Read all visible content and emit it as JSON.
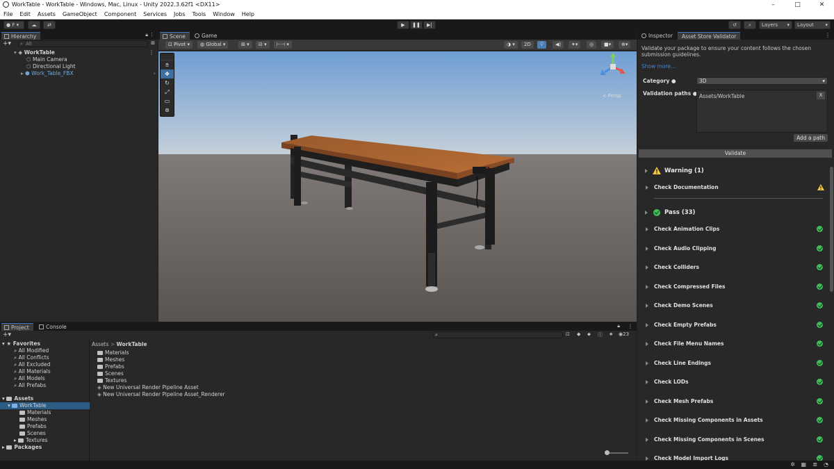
{
  "window": {
    "title": "WorkTable - WorkTable - Windows, Mac, Linux - Unity 2022.3.62f1 <DX11>",
    "buttons": [
      "–",
      "□",
      "✕"
    ]
  },
  "menu": [
    "File",
    "Edit",
    "Assets",
    "GameObject",
    "Component",
    "Services",
    "Jobs",
    "Tools",
    "Window",
    "Help"
  ],
  "toolbar": {
    "account_label": "F ▾",
    "layers_label": "Layers",
    "layout_label": "Layout",
    "play": "▶",
    "pause": "❚❚",
    "step": "▶|"
  },
  "hierarchy": {
    "tab_label": "Hierarchy",
    "search_placeholder": "All",
    "root": "WorkTable",
    "items": [
      "Main Camera",
      "Directional Light",
      "Work_Table_FBX"
    ]
  },
  "scene": {
    "tabs": [
      "Scene",
      "Game"
    ],
    "pivot_label": "Pivot",
    "global_label": "Global",
    "mode_2d": "2D",
    "gizmo_label": "< Persp"
  },
  "inspector": {
    "tabs": [
      "Inspector",
      "Asset Store Validator"
    ],
    "intro": "Validate your package to ensure your content follows the chosen submission guidelines.",
    "show_more": "Show more...",
    "category_label": "Category",
    "category_value": "3D",
    "validation_paths_label": "Validation paths",
    "path_value": "Assets/WorkTable",
    "remove_path": "X",
    "add_path": "Add a path",
    "validate": "Validate",
    "warning_header": "Warning (1)",
    "warning_items": [
      "Check Documentation"
    ],
    "pass_header": "Pass (33)",
    "pass_items": [
      "Check Animation Clips",
      "Check Audio Clipping",
      "Check Colliders",
      "Check Compressed Files",
      "Check Demo Scenes",
      "Check Empty Prefabs",
      "Check File Menu Names",
      "Check Line Endings",
      "Check LODs",
      "Check Mesh Prefabs",
      "Check Missing Components in Assets",
      "Check Missing Components in Scenes",
      "Check Model Import Logs"
    ]
  },
  "project": {
    "tabs": [
      "Project",
      "Console"
    ],
    "favorites_label": "Favorites",
    "favorites": [
      "All Modified",
      "All Conflicts",
      "All Excluded",
      "All Materials",
      "All Models",
      "All Prefabs"
    ],
    "assets_label": "Assets",
    "worktable_label": "WorkTable",
    "worktable_children": [
      "Materials",
      "Meshes",
      "Prefabs",
      "Scenes",
      "Textures"
    ],
    "packages_label": "Packages",
    "breadcrumb_root": "Assets",
    "breadcrumb_sep": ">",
    "breadcrumb_current": "WorkTable",
    "files": [
      "Materials",
      "Meshes",
      "Prefabs",
      "Scenes",
      "Textures",
      "New Universal Render Pipeline Asset",
      "New Universal Render Pipeline Asset_Renderer"
    ],
    "count_badge": "23"
  },
  "colors": {
    "accent": "#3a79bb",
    "pass": "#3fbf5a",
    "warning": "#f2c744",
    "selection": "#2c5d87"
  }
}
